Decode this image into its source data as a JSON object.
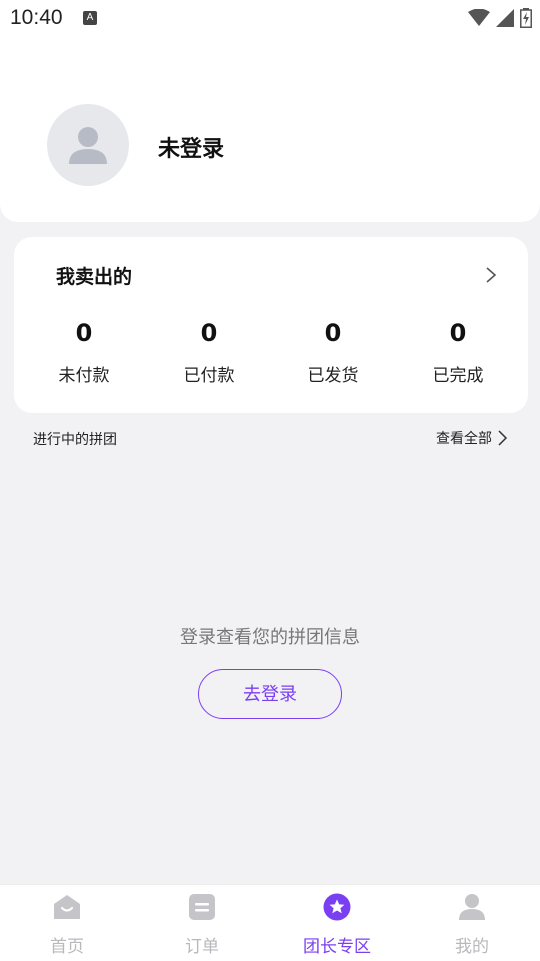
{
  "status_bar": {
    "time": "10:40",
    "notification_glyph": "A"
  },
  "profile": {
    "name": "未登录",
    "avatar_icon": "user-icon"
  },
  "sold_section": {
    "title": "我卖出的",
    "stats": [
      {
        "value": "0",
        "label": "未付款"
      },
      {
        "value": "0",
        "label": "已付款"
      },
      {
        "value": "0",
        "label": "已发货"
      },
      {
        "value": "0",
        "label": "已完成"
      }
    ]
  },
  "group_section": {
    "title": "进行中的拼团",
    "view_all": "查看全部",
    "empty_text": "登录查看您的拼团信息",
    "login_button": "去登录"
  },
  "tabbar": {
    "items": [
      {
        "label": "首页",
        "icon": "home-icon",
        "active": false
      },
      {
        "label": "订单",
        "icon": "order-icon",
        "active": false
      },
      {
        "label": "团长专区",
        "icon": "star-icon",
        "active": true
      },
      {
        "label": "我的",
        "icon": "profile-icon",
        "active": false
      }
    ]
  },
  "colors": {
    "accent": "#7b3ff2",
    "inactive_tab": "#b8b8bd",
    "background": "#f2f2f5",
    "card": "#ffffff"
  }
}
